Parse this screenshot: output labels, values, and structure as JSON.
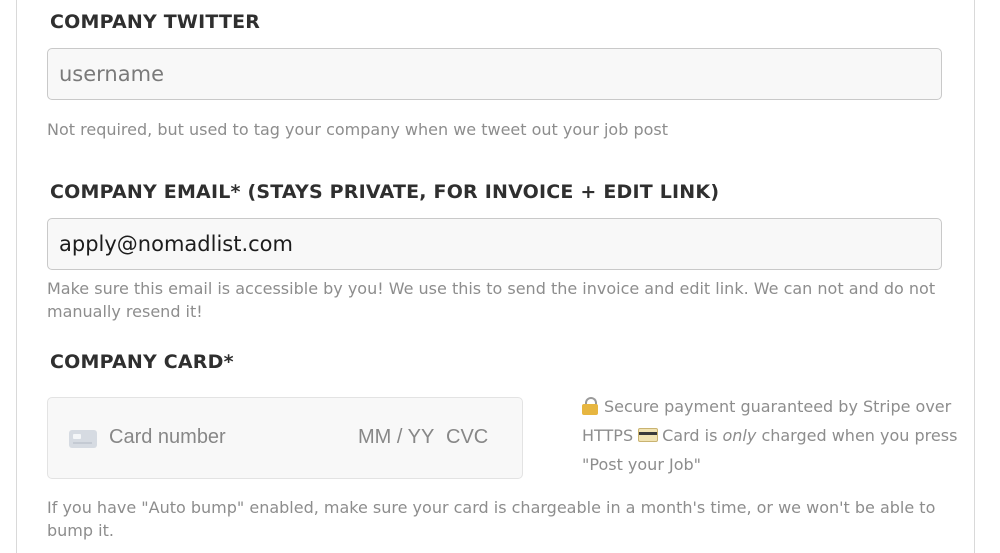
{
  "twitter": {
    "label": "COMPANY TWITTER",
    "placeholder": "username",
    "help": "Not required, but used to tag your company when we tweet out your job post"
  },
  "email": {
    "label": "COMPANY EMAIL* (STAYS PRIVATE, FOR INVOICE + EDIT LINK)",
    "value": "apply@nomadlist.com",
    "help": "Make sure this email is accessible by you! We use this to send the invoice and edit link. We can not and do not manually resend it!"
  },
  "card": {
    "label": "COMPANY CARD*",
    "number_placeholder": "Card number",
    "expiry_placeholder": "MM / YY",
    "cvc_placeholder": "CVC",
    "secure_text_1": "Secure payment guaranteed by Stripe over HTTPS",
    "secure_text_2": "Card is",
    "secure_text_em": "only",
    "secure_text_3": "charged when you press \"Post your Job\"",
    "help": "If you have \"Auto bump\" enabled, make sure your card is chargeable in a month's time, or we won't be able to bump it."
  },
  "icons": {
    "lock": "lock-icon",
    "credit_card": "credit-card-icon",
    "card_brand": "generic-card-icon"
  }
}
